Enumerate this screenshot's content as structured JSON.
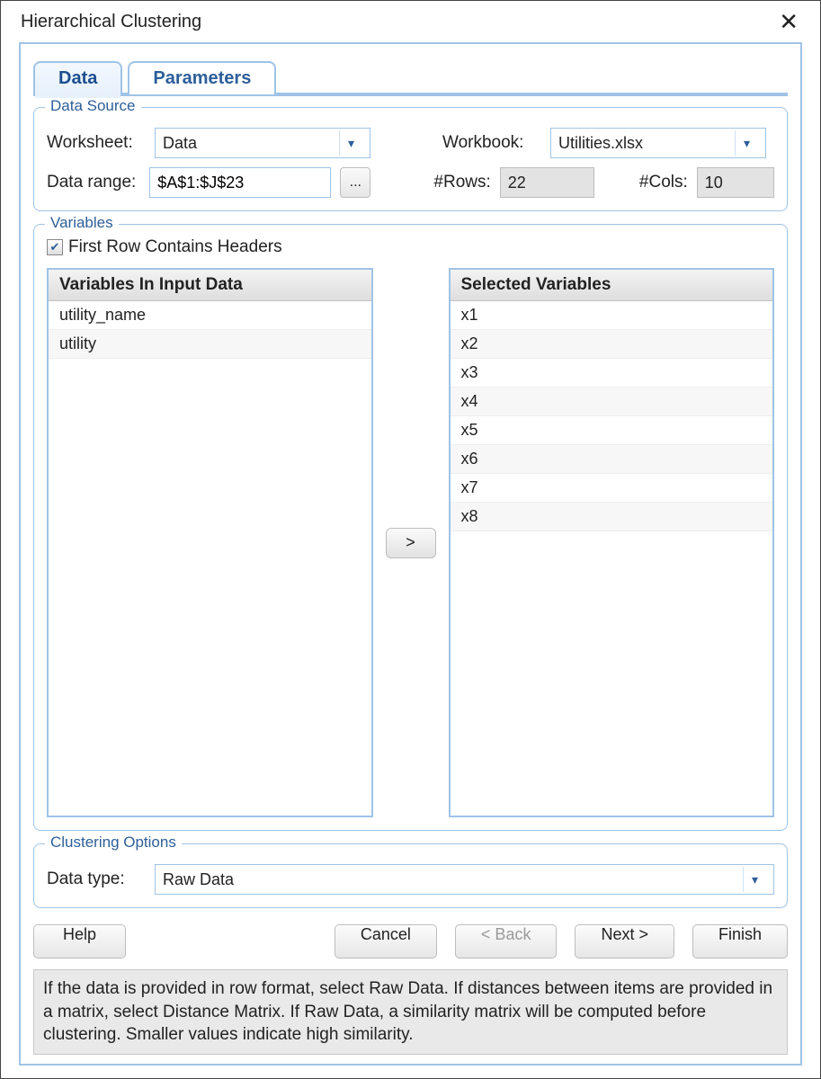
{
  "window": {
    "title": "Hierarchical Clustering"
  },
  "tabs": {
    "data": "Data",
    "parameters": "Parameters"
  },
  "data_source": {
    "legend": "Data Source",
    "worksheet_label": "Worksheet:",
    "worksheet_value": "Data",
    "workbook_label": "Workbook:",
    "workbook_value": "Utilities.xlsx",
    "data_range_label": "Data range:",
    "data_range_value": "$A$1:$J$23",
    "ellipsis": "...",
    "rows_label": "#Rows:",
    "rows_value": "22",
    "cols_label": "#Cols:",
    "cols_value": "10"
  },
  "variables": {
    "legend": "Variables",
    "first_row_headers_label": "First Row Contains Headers",
    "input_header": "Variables In Input Data",
    "input_items": [
      "utility_name",
      "utility"
    ],
    "selected_header": "Selected Variables",
    "selected_items": [
      "x1",
      "x2",
      "x3",
      "x4",
      "x5",
      "x6",
      "x7",
      "x8"
    ],
    "move_label": ">"
  },
  "clustering_options": {
    "legend": "Clustering Options",
    "data_type_label": "Data type:",
    "data_type_value": "Raw Data"
  },
  "buttons": {
    "help": "Help",
    "cancel": "Cancel",
    "back": "< Back",
    "next": "Next >",
    "finish": "Finish"
  },
  "hint": "If the data is provided in row format, select Raw Data. If distances between items are provided in a matrix, select Distance Matrix. If Raw Data, a similarity matrix will be computed before clustering. Smaller values indicate high similarity."
}
